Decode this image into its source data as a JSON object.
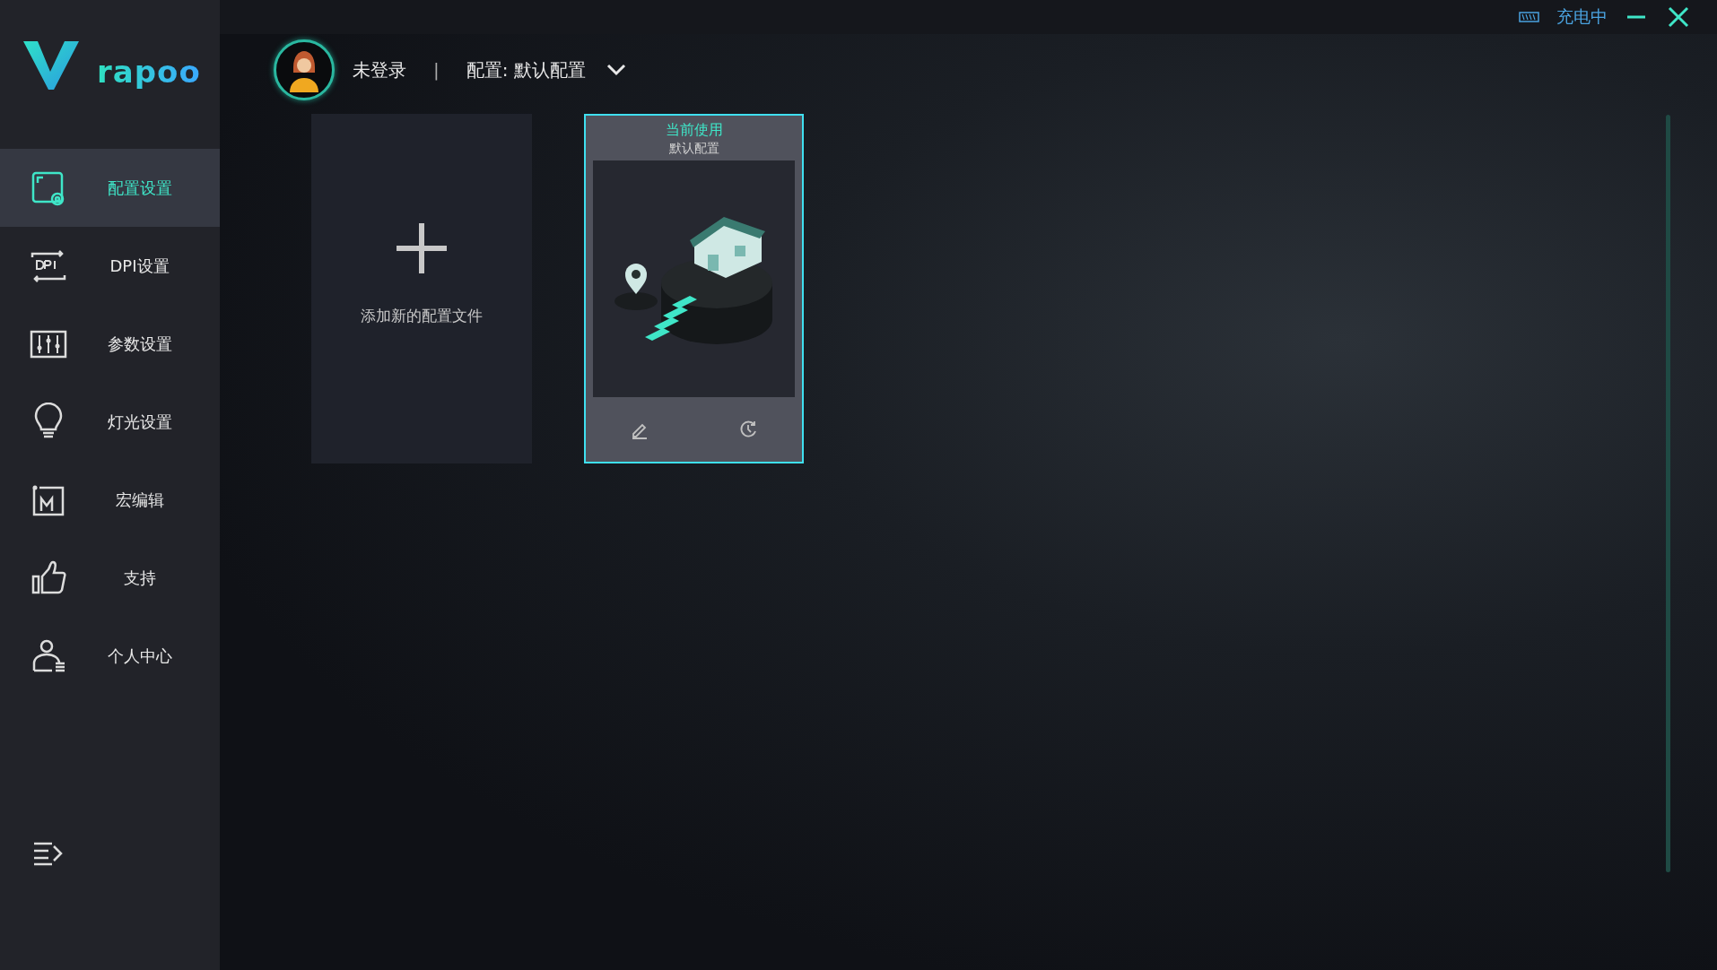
{
  "logo": {
    "text": "rapoo"
  },
  "title_bar": {
    "battery_status": "充电中"
  },
  "header": {
    "login_status": "未登录",
    "separator": "|",
    "profile_label": "配置: 默认配置"
  },
  "sidebar": {
    "items": [
      {
        "kind": "profile",
        "label": "配置设置",
        "selected": true
      },
      {
        "kind": "dpi",
        "label": "DPI设置",
        "selected": false
      },
      {
        "kind": "params",
        "label": "参数设置",
        "selected": false
      },
      {
        "kind": "light",
        "label": "灯光设置",
        "selected": false
      },
      {
        "kind": "macro",
        "label": "宏编辑",
        "selected": false
      },
      {
        "kind": "support",
        "label": "支持",
        "selected": false
      },
      {
        "kind": "user",
        "label": "个人中心",
        "selected": false
      }
    ]
  },
  "profiles": [
    {
      "kind": "add",
      "label": "添加新的配置文件"
    },
    {
      "kind": "profile",
      "status": "当前使用",
      "name": "默认配置",
      "selected": true
    }
  ]
}
